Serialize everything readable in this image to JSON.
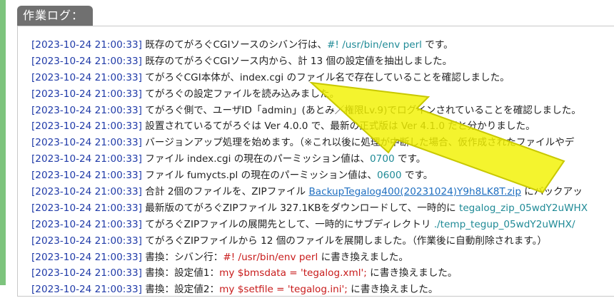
{
  "section": {
    "title": "作業ログ："
  },
  "colors": {
    "timestamp": "#1f3aa8",
    "teal": "#1f8a96",
    "red": "#c81b1b",
    "link": "#1f6fc0",
    "accent_bar": "#7dc47d",
    "arrow": "#f2f200"
  },
  "log": [
    {
      "ts": "[2023-10-24 21:00:33]",
      "segments": [
        {
          "text": " 既存のてがろぐCGIソースのシバン行は、",
          "style": "plain"
        },
        {
          "text": "#! /usr/bin/env perl",
          "style": "teal"
        },
        {
          "text": " です。",
          "style": "plain"
        }
      ]
    },
    {
      "ts": "[2023-10-24 21:00:33]",
      "segments": [
        {
          "text": " 既存のてがろぐCGIソース内から、計 13 個の設定値を抽出しました。",
          "style": "plain"
        }
      ]
    },
    {
      "ts": "[2023-10-24 21:00:33]",
      "segments": [
        {
          "text": " てがろぐCGI本体が、index.cgi のファイル名で存在していることを確認しました。",
          "style": "plain"
        }
      ]
    },
    {
      "ts": "[2023-10-24 21:00:33]",
      "segments": [
        {
          "text": " てがろぐの設定ファイルを読み込みました。",
          "style": "plain"
        }
      ]
    },
    {
      "ts": "[2023-10-24 21:00:33]",
      "segments": [
        {
          "text": " てがろぐ側で、ユーザID「admin」(あとみ／権限Lv.9)でログインされていることを確認しました。",
          "style": "plain"
        }
      ]
    },
    {
      "ts": "[2023-10-24 21:00:33]",
      "segments": [
        {
          "text": " 設置されているてがろぐは Ver 4.0.0 で、最新の正式版は Ver 4.1.0 だと分かりました。",
          "style": "plain"
        }
      ]
    },
    {
      "ts": "[2023-10-24 21:00:33]",
      "segments": [
        {
          "text": " バージョンアップ処理を始めます。（※これ以後に処理が中断した場合、仮作成されたファイルやデ",
          "style": "plain"
        }
      ]
    },
    {
      "ts": "[2023-10-24 21:00:33]",
      "segments": [
        {
          "text": " ファイル index.cgi の現在のパーミッション値は、",
          "style": "plain"
        },
        {
          "text": "0700",
          "style": "teal"
        },
        {
          "text": " です。",
          "style": "plain"
        }
      ]
    },
    {
      "ts": "[2023-10-24 21:00:33]",
      "segments": [
        {
          "text": " ファイル fumycts.pl の現在のパーミッション値は、",
          "style": "plain"
        },
        {
          "text": "0600",
          "style": "teal"
        },
        {
          "text": " です。",
          "style": "plain"
        }
      ]
    },
    {
      "ts": "[2023-10-24 21:00:33]",
      "segments": [
        {
          "text": " 合計 2個のファイルを、ZIPファイル ",
          "style": "plain"
        },
        {
          "text": "BackupTegalog400(20231024)Y9h8LK8T.zip",
          "style": "link"
        },
        {
          "text": " にバックアッ",
          "style": "plain"
        }
      ]
    },
    {
      "ts": "[2023-10-24 21:00:33]",
      "segments": [
        {
          "text": " 最新版のてがろぐZIPファイル 327.1KBをダウンロードして、一時的に ",
          "style": "plain"
        },
        {
          "text": "tegalog_zip_05wdY2uWHX",
          "style": "teal"
        }
      ]
    },
    {
      "ts": "[2023-10-24 21:00:33]",
      "segments": [
        {
          "text": " てがろぐZIPファイルの展開先として、一時的にサブディレクトリ ",
          "style": "plain"
        },
        {
          "text": "./temp_tegup_05wdY2uWHX/",
          "style": "teal"
        }
      ]
    },
    {
      "ts": "[2023-10-24 21:00:33]",
      "segments": [
        {
          "text": " てがろぐZIPファイルから 12 個のファイルを展開しました。（作業後に自動削除されます。）",
          "style": "plain"
        }
      ]
    },
    {
      "ts": "[2023-10-24 21:00:33]",
      "segments": [
        {
          "text": " 書換：シバン行：",
          "style": "plain"
        },
        {
          "text": "#! /usr/bin/env perl",
          "style": "red"
        },
        {
          "text": " に書き換えました。",
          "style": "plain"
        }
      ]
    },
    {
      "ts": "[2023-10-24 21:00:33]",
      "segments": [
        {
          "text": " 書換：設定値1：",
          "style": "plain"
        },
        {
          "text": "my $bmsdata = 'tegalog.xml';",
          "style": "red"
        },
        {
          "text": " に書き換えました。",
          "style": "plain"
        }
      ]
    },
    {
      "ts": "[2023-10-24 21:00:33]",
      "segments": [
        {
          "text": " 書換：設定値2：",
          "style": "plain"
        },
        {
          "text": "my $setfile = 'tegalog.ini';",
          "style": "red"
        },
        {
          "text": " に書き換えました。",
          "style": "plain"
        }
      ]
    }
  ]
}
